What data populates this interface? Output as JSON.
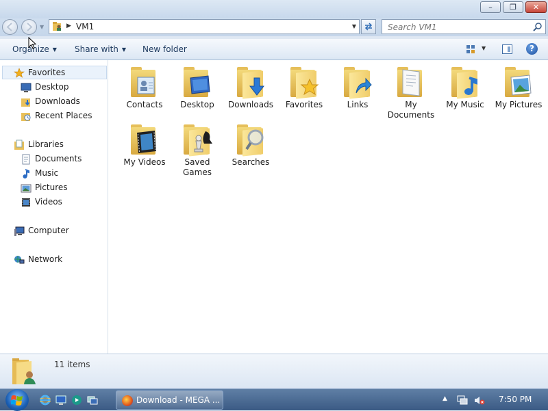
{
  "window": {
    "controls": {
      "minimize": "–",
      "maximize": "❐",
      "close": "✕"
    }
  },
  "address_bar": {
    "path": "VM1",
    "search_placeholder": "Search VM1"
  },
  "toolbar": {
    "organize": "Organize",
    "share_with": "Share with",
    "new_folder": "New folder",
    "help": "?"
  },
  "nav": {
    "favorites": {
      "label": "Favorites",
      "items": [
        "Desktop",
        "Downloads",
        "Recent Places"
      ]
    },
    "libraries": {
      "label": "Libraries",
      "items": [
        "Documents",
        "Music",
        "Pictures",
        "Videos"
      ]
    },
    "computer": "Computer",
    "network": "Network"
  },
  "items": [
    {
      "label": "Contacts",
      "icon": "contacts-icon"
    },
    {
      "label": "Desktop",
      "icon": "desktop-icon"
    },
    {
      "label": "Downloads",
      "icon": "download-arrow-icon"
    },
    {
      "label": "Favorites",
      "icon": "star-icon"
    },
    {
      "label": "Links",
      "icon": "link-arrow-icon"
    },
    {
      "label": "My Documents",
      "icon": "document-icon"
    },
    {
      "label": "My Music",
      "icon": "music-note-icon"
    },
    {
      "label": "My Pictures",
      "icon": "picture-icon"
    },
    {
      "label": "My Videos",
      "icon": "film-icon"
    },
    {
      "label": "Saved Games",
      "icon": "chess-piece-icon"
    },
    {
      "label": "Searches",
      "icon": "magnifier-icon"
    }
  ],
  "status": {
    "count": "11 items"
  },
  "taskbar": {
    "active_task": "Download - MEGA ...",
    "clock": "7:50 PM"
  }
}
